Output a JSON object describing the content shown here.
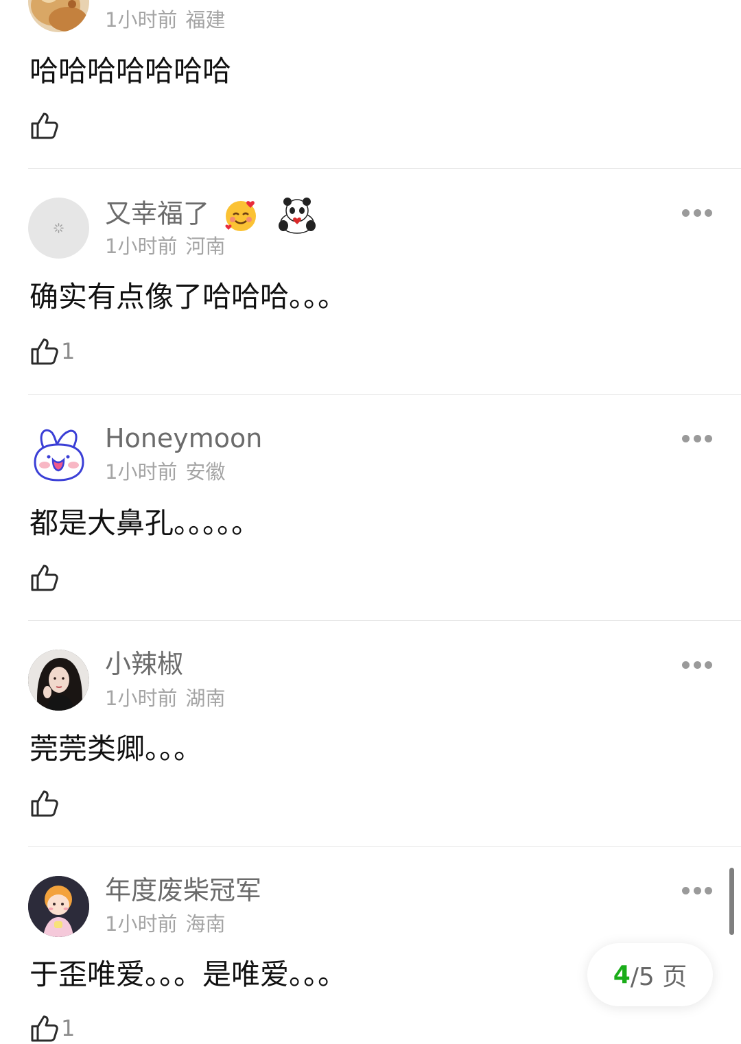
{
  "comments": [
    {
      "username": "",
      "time": "1小时前",
      "location": "福建",
      "content": "哈哈哈哈哈哈哈",
      "likes": "",
      "avatar_icon": "food-avatar"
    },
    {
      "username": "又幸福了",
      "time": "1小时前",
      "location": "河南",
      "content": "确实有点像了哈哈哈。。。",
      "likes": "1",
      "avatar_icon": "loading-avatar"
    },
    {
      "username": "Honeymoon",
      "time": "1小时前",
      "location": "安徽",
      "content": "都是大鼻孔。。。。。",
      "likes": "",
      "avatar_icon": "bunny-avatar"
    },
    {
      "username": "小辣椒",
      "time": "1小时前",
      "location": "湖南",
      "content": "莞莞类卿。。。",
      "likes": "",
      "avatar_icon": "portrait-avatar"
    },
    {
      "username": "年度废柴冠军",
      "time": "1小时前",
      "location": "海南",
      "content": "于歪唯爱。。。是唯爱。。。",
      "likes": "1",
      "avatar_icon": "cartoon-avatar"
    }
  ],
  "pager": {
    "current": "4",
    "total": "/5 页"
  },
  "colors": {
    "accent": "#1aad19",
    "username": "#6b6b6b",
    "meta": "#a4a4a4",
    "divider": "#e6e6e6"
  }
}
